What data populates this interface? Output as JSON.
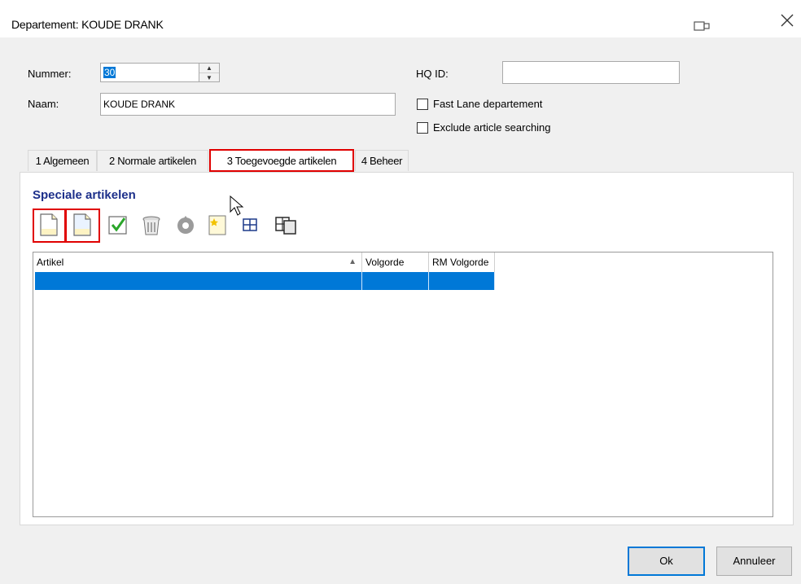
{
  "window": {
    "title": "Departement: KOUDE DRANK"
  },
  "form": {
    "nummer_label": "Nummer:",
    "nummer_value": "30",
    "naam_label": "Naam:",
    "naam_value": "KOUDE DRANK",
    "hqid_label": "HQ ID:",
    "hqid_value": "",
    "fast_lane_label": "Fast Lane departement",
    "fast_lane_checked": false,
    "exclude_label": "Exclude article searching",
    "exclude_checked": false
  },
  "tabs": [
    {
      "label": "1 Algemeen"
    },
    {
      "label": "2 Normale artikelen"
    },
    {
      "label": "3 Toegevoegde artikelen",
      "active": true
    },
    {
      "label": "4 Beheer"
    }
  ],
  "section": {
    "title": "Speciale artikelen"
  },
  "toolbar": {
    "icons": [
      "new-document-icon",
      "new-document-copy-icon",
      "checkmark-icon",
      "trash-bin-icon",
      "refresh-gear-icon",
      "favorite-note-icon",
      "grid-icon",
      "window-copy-icon"
    ]
  },
  "grid": {
    "columns": [
      "Artikel",
      "Volgorde",
      "RM Volgorde"
    ],
    "sort_indicator": "▲",
    "rows": [
      {
        "artikel": "",
        "volgorde": "",
        "rm_volgorde": "",
        "selected": true
      }
    ]
  },
  "buttons": {
    "ok": "Ok",
    "cancel": "Annuleer"
  },
  "colors": {
    "accent": "#0078d7",
    "highlight": "#e00000",
    "section_title": "#1c2f8a"
  }
}
